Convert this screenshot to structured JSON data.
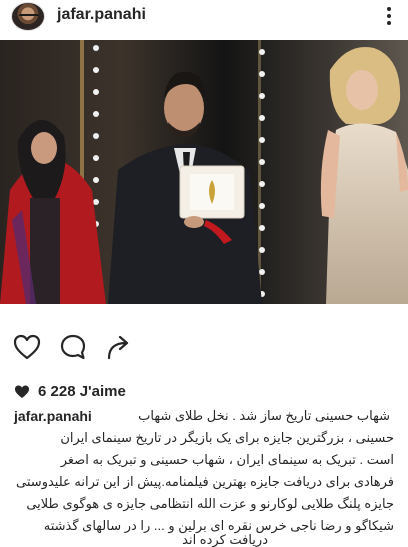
{
  "header": {
    "username": "jafar.panahi",
    "avatar_icon": "profile-photo",
    "more_icon": "more-vertical-icon"
  },
  "post": {
    "image_description_icon": "photo",
    "actions": {
      "like_icon": "heart-outline-icon",
      "comment_icon": "comment-bubble-icon",
      "share_icon": "share-arrow-icon"
    },
    "likes_text": "6 228 J'aime",
    "caption_username": "jafar.panahi",
    "caption_lines": [
      "شهاب حسینی تاریخ ساز شد . نخل طلای شهاب",
      "حسینی ، بزرگترین جایزه برای یک بازیگر در  تاریخ سینمای ایران",
      "است . تبریک به سینمای ایران ، شهاب حسینی و تبریک به اصغر",
      "فرهادی برای دریافت جایزه بهترین فیلمنامه.پیش از این ترانه علیدوستی",
      "جایزه پلنگ طلایی  لوکارنو و عزت الله انتظامی جایزه ی هوگوی طلایی",
      "شیکاگو و رضا ناجی خرس نقره ای برلین و ... را در سالهای گذشته",
      "دریافت کرده اند"
    ]
  },
  "colors": {
    "text": "#262626",
    "background": "#ffffff"
  }
}
